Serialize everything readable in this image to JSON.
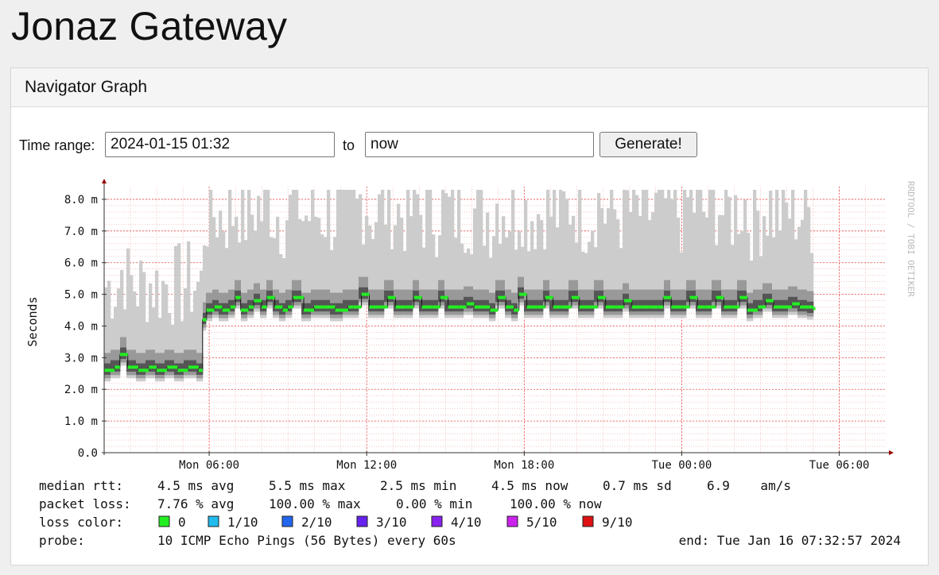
{
  "page": {
    "title": "Jonaz Gateway"
  },
  "panel": {
    "heading": "Navigator Graph"
  },
  "time_range": {
    "label": "Time range:",
    "start_value": "2024-01-15 01:32",
    "to_label": "to",
    "end_value": "now",
    "button_label": "Generate!"
  },
  "colors": {
    "median": "#22ee22",
    "grid": "#f0a0a0",
    "smoke_light": "#cccccc",
    "axis": "#990000"
  },
  "chart_data": {
    "type": "area",
    "ylabel": "Seconds",
    "watermark": "RRDTOOL / TOBI OETIKER",
    "y_ticks": [
      "0.0",
      "1.0 m",
      "2.0 m",
      "3.0 m",
      "4.0 m",
      "5.0 m",
      "6.0 m",
      "7.0 m",
      "8.0 m"
    ],
    "y_unit_values": [
      0,
      1,
      2,
      3,
      4,
      5,
      6,
      7,
      8
    ],
    "ylim": [
      0,
      8.4
    ],
    "x_ticks": [
      "Mon 06:00",
      "Mon 12:00",
      "Mon 18:00",
      "Tue 00:00",
      "Tue 06:00"
    ],
    "x_tick_hours": [
      6,
      12,
      18,
      24,
      30
    ],
    "xlim_hours": [
      2.0,
      31.8
    ],
    "data_end_hour": 29.0,
    "grid": true,
    "series": [
      {
        "name": "median rtt",
        "samples": [
          [
            2.0,
            2.6
          ],
          [
            2.4,
            2.7
          ],
          [
            2.6,
            3.1
          ],
          [
            2.9,
            2.7
          ],
          [
            3.3,
            2.6
          ],
          [
            3.7,
            2.7
          ],
          [
            4.0,
            2.6
          ],
          [
            4.4,
            2.7
          ],
          [
            4.8,
            2.6
          ],
          [
            5.2,
            2.7
          ],
          [
            5.6,
            2.6
          ],
          [
            5.75,
            4.2
          ],
          [
            5.9,
            4.5
          ],
          [
            6.2,
            4.6
          ],
          [
            6.5,
            4.5
          ],
          [
            6.8,
            4.6
          ],
          [
            7.0,
            4.9
          ],
          [
            7.2,
            4.5
          ],
          [
            7.5,
            4.6
          ],
          [
            7.7,
            4.8
          ],
          [
            8.0,
            4.6
          ],
          [
            8.2,
            4.9
          ],
          [
            8.5,
            4.6
          ],
          [
            8.8,
            4.5
          ],
          [
            9.0,
            4.6
          ],
          [
            9.2,
            4.9
          ],
          [
            9.6,
            4.5
          ],
          [
            10.0,
            4.6
          ],
          [
            10.4,
            4.6
          ],
          [
            10.8,
            4.5
          ],
          [
            11.3,
            4.6
          ],
          [
            11.5,
            4.6
          ],
          [
            11.8,
            5.0
          ],
          [
            12.1,
            4.6
          ],
          [
            12.5,
            4.6
          ],
          [
            12.8,
            4.9
          ],
          [
            13.1,
            4.6
          ],
          [
            13.5,
            4.6
          ],
          [
            13.8,
            4.9
          ],
          [
            14.1,
            4.6
          ],
          [
            14.5,
            4.6
          ],
          [
            14.8,
            4.9
          ],
          [
            15.1,
            4.6
          ],
          [
            15.5,
            4.6
          ],
          [
            15.8,
            4.7
          ],
          [
            16.1,
            4.6
          ],
          [
            16.4,
            4.6
          ],
          [
            16.7,
            4.5
          ],
          [
            17.0,
            4.9
          ],
          [
            17.3,
            4.6
          ],
          [
            17.6,
            4.5
          ],
          [
            17.8,
            5.0
          ],
          [
            18.1,
            4.6
          ],
          [
            18.5,
            4.6
          ],
          [
            18.8,
            4.9
          ],
          [
            19.1,
            4.6
          ],
          [
            19.4,
            4.6
          ],
          [
            19.8,
            4.9
          ],
          [
            20.1,
            4.6
          ],
          [
            20.5,
            4.6
          ],
          [
            20.8,
            4.9
          ],
          [
            21.1,
            4.6
          ],
          [
            21.5,
            4.6
          ],
          [
            21.8,
            4.8
          ],
          [
            22.1,
            4.6
          ],
          [
            22.5,
            4.6
          ],
          [
            22.8,
            4.6
          ],
          [
            23.1,
            4.6
          ],
          [
            23.3,
            4.9
          ],
          [
            23.6,
            4.6
          ],
          [
            24.0,
            4.6
          ],
          [
            24.3,
            4.9
          ],
          [
            24.6,
            4.6
          ],
          [
            24.9,
            4.6
          ],
          [
            25.3,
            4.9
          ],
          [
            25.6,
            4.6
          ],
          [
            25.9,
            4.6
          ],
          [
            26.2,
            4.9
          ],
          [
            26.5,
            4.5
          ],
          [
            26.9,
            4.6
          ],
          [
            27.2,
            4.8
          ],
          [
            27.5,
            4.6
          ],
          [
            27.8,
            4.6
          ],
          [
            28.2,
            4.7
          ],
          [
            28.5,
            4.6
          ],
          [
            29.0,
            4.55
          ]
        ]
      }
    ],
    "legend": {
      "median_rtt": {
        "label": "median rtt:",
        "avg": "4.5 ms avg",
        "max": "5.5 ms max",
        "min": "2.5 ms min",
        "now": "4.5 ms now",
        "sd": "0.7 ms sd",
        "am": "6.9    am/s"
      },
      "packet_loss": {
        "label": "packet loss:",
        "avg": "7.76 % avg",
        "max": "100.00 % max",
        "min": "0.00 % min",
        "now": "100.00 % now"
      },
      "loss_color": {
        "label": "loss color:",
        "items": [
          {
            "label": "0",
            "color": "#22ee22"
          },
          {
            "label": "1/10",
            "color": "#22bbee"
          },
          {
            "label": "2/10",
            "color": "#2266ee"
          },
          {
            "label": "3/10",
            "color": "#6622ee"
          },
          {
            "label": "4/10",
            "color": "#8822ee"
          },
          {
            "label": "5/10",
            "color": "#cc22ee"
          },
          {
            "label": "9/10",
            "color": "#dd1111"
          }
        ]
      },
      "probe": {
        "label": "probe:",
        "value": "10 ICMP Echo Pings (56 Bytes) every 60s",
        "end": "end: Tue Jan 16 07:32:57 2024"
      }
    }
  }
}
